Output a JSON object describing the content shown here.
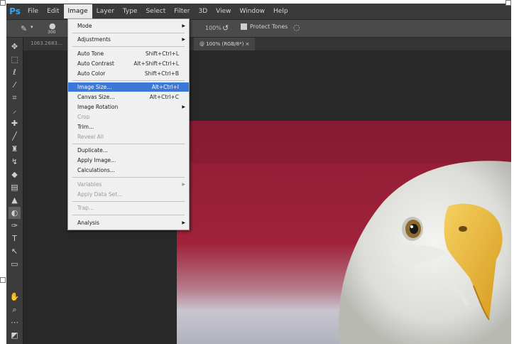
{
  "app": {
    "logo": "Ps"
  },
  "menubar": [
    "File",
    "Edit",
    "Image",
    "Layer",
    "Type",
    "Select",
    "Filter",
    "3D",
    "View",
    "Window",
    "Help"
  ],
  "options_bar": {
    "size_value": "300",
    "opacity_pct": "100%",
    "protect_tones_label": "Protect Tones"
  },
  "tabs": {
    "inactive": "1063.2683...",
    "active": "@ 100% (RGB/8*) ×"
  },
  "toolbar_icons": [
    "move-icon",
    "marquee-icon",
    "lasso-icon",
    "quick-select-icon",
    "crop-icon",
    "eyedropper-icon",
    "healing-brush-icon",
    "brush-icon",
    "clone-stamp-icon",
    "history-brush-icon",
    "eraser-icon",
    "gradient-icon",
    "blur-icon",
    "dodge-icon",
    "pen-icon",
    "type-icon",
    "path-select-icon",
    "rectangle-icon",
    "hand-icon",
    "zoom-icon",
    "more-tools-icon",
    "color-swatches-icon"
  ],
  "image_menu": {
    "items": [
      {
        "label": "Mode",
        "shortcut": "",
        "submenu": true,
        "disabled": false,
        "highlight": false
      },
      {
        "label": "Adjustments",
        "shortcut": "",
        "submenu": true,
        "disabled": false,
        "highlight": false
      },
      {
        "label": "Auto Tone",
        "shortcut": "Shift+Ctrl+L",
        "submenu": false,
        "disabled": false,
        "highlight": false
      },
      {
        "label": "Auto Contrast",
        "shortcut": "Alt+Shift+Ctrl+L",
        "submenu": false,
        "disabled": false,
        "highlight": false
      },
      {
        "label": "Auto Color",
        "shortcut": "Shift+Ctrl+B",
        "submenu": false,
        "disabled": false,
        "highlight": false
      },
      {
        "label": "Image Size...",
        "shortcut": "Alt+Ctrl+I",
        "submenu": false,
        "disabled": false,
        "highlight": true
      },
      {
        "label": "Canvas Size...",
        "shortcut": "Alt+Ctrl+C",
        "submenu": false,
        "disabled": false,
        "highlight": false
      },
      {
        "label": "Image Rotation",
        "shortcut": "",
        "submenu": true,
        "disabled": false,
        "highlight": false
      },
      {
        "label": "Crop",
        "shortcut": "",
        "submenu": false,
        "disabled": true,
        "highlight": false
      },
      {
        "label": "Trim...",
        "shortcut": "",
        "submenu": false,
        "disabled": false,
        "highlight": false
      },
      {
        "label": "Reveal All",
        "shortcut": "",
        "submenu": false,
        "disabled": true,
        "highlight": false
      },
      {
        "label": "Duplicate...",
        "shortcut": "",
        "submenu": false,
        "disabled": false,
        "highlight": false
      },
      {
        "label": "Apply Image...",
        "shortcut": "",
        "submenu": false,
        "disabled": false,
        "highlight": false
      },
      {
        "label": "Calculations...",
        "shortcut": "",
        "submenu": false,
        "disabled": false,
        "highlight": false
      },
      {
        "label": "Variables",
        "shortcut": "",
        "submenu": true,
        "disabled": true,
        "highlight": false
      },
      {
        "label": "Apply Data Set...",
        "shortcut": "",
        "submenu": false,
        "disabled": true,
        "highlight": false
      },
      {
        "label": "Trap...",
        "shortcut": "",
        "submenu": false,
        "disabled": true,
        "highlight": false
      },
      {
        "label": "Analysis",
        "shortcut": "",
        "submenu": true,
        "disabled": false,
        "highlight": false
      }
    ]
  },
  "colors": {
    "menu_highlight": "#3c78d8",
    "ps_blue": "#31a8ff",
    "panel_dark": "#282828",
    "background_red": "#9e1b32",
    "eagle_beak": "#e8b830"
  }
}
